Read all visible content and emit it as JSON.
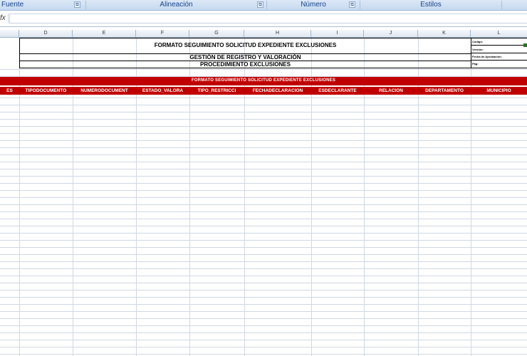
{
  "ribbon": {
    "groups": [
      {
        "label": "Fuente"
      },
      {
        "label": "Alineación"
      },
      {
        "label": "Número"
      },
      {
        "label": "Estilos"
      }
    ],
    "launcher_glyph": "⧉"
  },
  "formula_bar": {
    "fx_label": "fx",
    "value": ""
  },
  "columns": [
    "D",
    "E",
    "F",
    "G",
    "H",
    "I",
    "J",
    "K",
    "L"
  ],
  "header": {
    "title1": "FORMATO SEGUIMIENTO SOLICITUD EXPEDIENTE EXCLUSIONES",
    "title2": "GESTIÓN DE REGISTRO Y VALORACIÓN",
    "title3": "PROCEDIMIENTO EXCLUSIONES",
    "meta": [
      "Código:",
      "Versión:",
      "Fecha de Aprobación:",
      "Pág:"
    ]
  },
  "table": {
    "banner": "FORMATO SEGUIMIENTO SOLICITUD EXPEDIENTE EXCLUSIONES",
    "headers": [
      "ES",
      "TIPODOCUMENTO",
      "NUMERODOCUMENT",
      "ESTADO_VALORA",
      "TIPO_RESTRICCI",
      "FECHADECLARACION",
      "ESDECLARANTE",
      "RELACION",
      "DEPARTAMENTO",
      "MUNICIPIO"
    ]
  },
  "colors": {
    "header_red": "#c00000",
    "ribbon_text": "#15428b"
  }
}
